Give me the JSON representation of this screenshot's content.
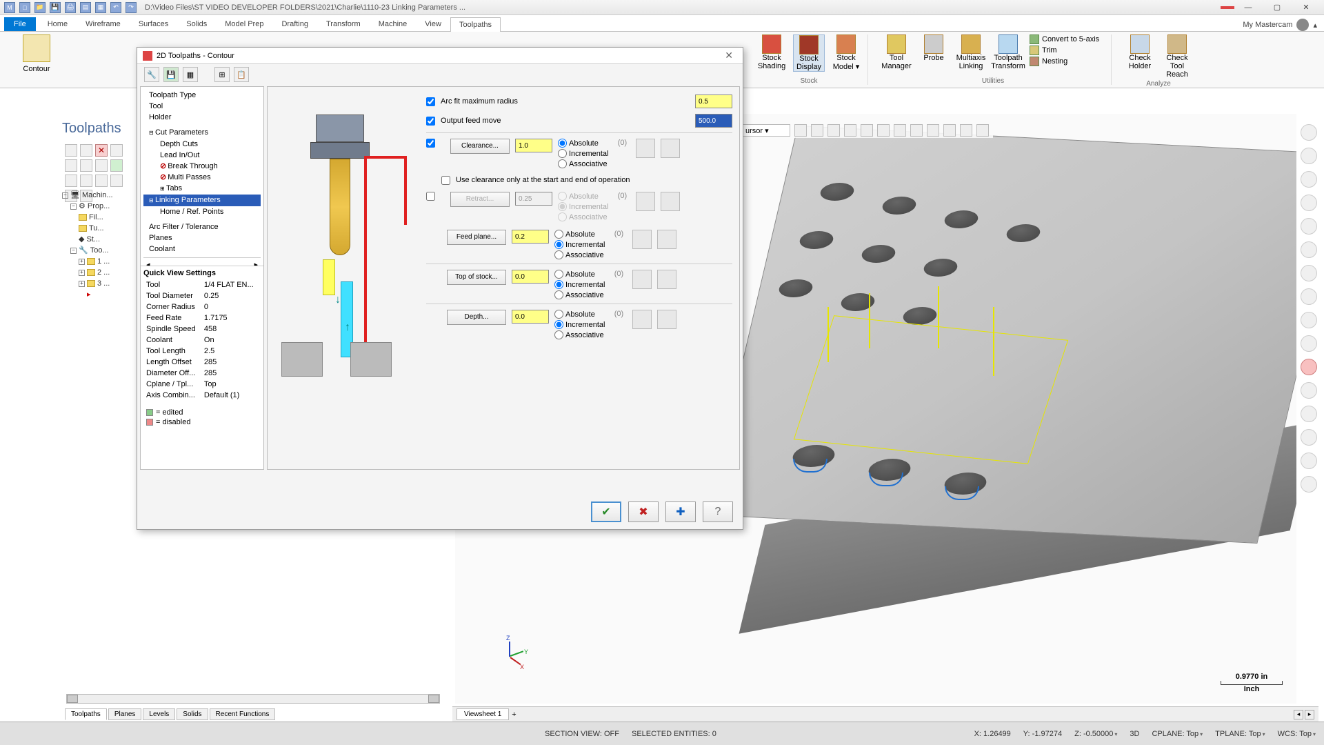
{
  "titlebar": {
    "path": "D:\\Video Files\\ST VIDEO DEVELOPER FOLDERS\\2021\\Charlie\\1110-23 Linking Parameters ...",
    "badge": ""
  },
  "ribbon": {
    "file": "File",
    "tabs": [
      "Home",
      "Wireframe",
      "Surfaces",
      "Solids",
      "Model Prep",
      "Drafting",
      "Transform",
      "Machine",
      "View",
      "Toolpaths"
    ],
    "active_tab": "Toolpaths",
    "user_label": "My Mastercam",
    "contour_label": "Contour",
    "groups": {
      "stock": {
        "label": "Stock",
        "items": [
          "Stock Shading",
          "Stock Display",
          "Stock Model ▾"
        ]
      },
      "utilities": {
        "label": "Utilities",
        "items": [
          "Tool Manager",
          "Probe",
          "Multiaxis Linking",
          "Toolpath Transform"
        ],
        "small": [
          {
            "label": "Convert to 5-axis"
          },
          {
            "label": "Trim"
          },
          {
            "label": "Nesting"
          }
        ]
      },
      "analyze": {
        "label": "Analyze",
        "items": [
          "Check Holder",
          "Check Tool Reach"
        ]
      }
    }
  },
  "toolpaths_panel_label": "Toolpaths",
  "tree": {
    "machine": "Machin...",
    "prop": "Prop...",
    "fil": "Fil...",
    "tu": "Tu...",
    "st": "St...",
    "too": "Too...",
    "n1": "1 ...",
    "n2": "2 ...",
    "n3": "3 ..."
  },
  "dialog": {
    "title": "2D Toolpaths - Contour",
    "tree": [
      {
        "label": "Toolpath Type",
        "level": 1
      },
      {
        "label": "Tool",
        "level": 1
      },
      {
        "label": "Holder",
        "level": 1
      },
      {
        "label": "Cut Parameters",
        "level": 1,
        "expandable": true
      },
      {
        "label": "Depth Cuts",
        "level": 2
      },
      {
        "label": "Lead In/Out",
        "level": 2
      },
      {
        "label": "Break Through",
        "level": 2,
        "off": true
      },
      {
        "label": "Multi Passes",
        "level": 2,
        "off": true
      },
      {
        "label": "Tabs",
        "level": 2,
        "expandable": true
      },
      {
        "label": "Linking Parameters",
        "level": 1,
        "selected": true,
        "expandable": true
      },
      {
        "label": "Home / Ref. Points",
        "level": 2
      },
      {
        "label": "Arc Filter / Tolerance",
        "level": 1
      },
      {
        "label": "Planes",
        "level": 1
      },
      {
        "label": "Coolant",
        "level": 1
      }
    ],
    "quick_view": {
      "title": "Quick View Settings",
      "rows": [
        [
          "Tool",
          "1/4 FLAT EN..."
        ],
        [
          "Tool Diameter",
          "0.25"
        ],
        [
          "Corner Radius",
          "0"
        ],
        [
          "Feed Rate",
          "1.7175"
        ],
        [
          "Spindle Speed",
          "458"
        ],
        [
          "Coolant",
          "On"
        ],
        [
          "Tool Length",
          "2.5"
        ],
        [
          "Length Offset",
          "285"
        ],
        [
          "Diameter Off...",
          "285"
        ],
        [
          "Cplane / Tpl...",
          "Top"
        ],
        [
          "Axis Combin...",
          "Default (1)"
        ]
      ]
    },
    "legend": {
      "edited": "= edited",
      "disabled": "= disabled"
    },
    "params": {
      "arc_fit_label": "Arc fit maximum radius",
      "arc_fit_value": "0.5",
      "output_feed_label": "Output feed move",
      "output_feed_value": "500.0",
      "clearance_btn": "Clearance...",
      "clearance_value": "1.0",
      "clearance_mode": {
        "absolute": "Absolute",
        "incremental": "Incremental",
        "associative": "Associative"
      },
      "use_clearance_only": "Use clearance only at the start and end of operation",
      "retract_btn": "Retract...",
      "retract_value": "0.25",
      "feed_plane_btn": "Feed plane...",
      "feed_plane_value": "0.2",
      "top_stock_btn": "Top of stock...",
      "top_stock_value": "0.0",
      "depth_btn": "Depth...",
      "depth_value": "0.0",
      "assoc_count": "(0)"
    }
  },
  "selbar": {
    "cursor_label": "ursor ▾"
  },
  "triad": {
    "x": "X",
    "y": "Y",
    "z": "Z"
  },
  "scale": {
    "value": "0.9770 in",
    "unit": "Inch"
  },
  "viewsheets": {
    "tab": "Viewsheet 1"
  },
  "bottom_tabs": [
    "Toolpaths",
    "Planes",
    "Levels",
    "Solids",
    "Recent Functions"
  ],
  "status": {
    "section": "SECTION VIEW: OFF",
    "selected": "SELECTED ENTITIES: 0",
    "x_label": "X:",
    "x": "1.26499",
    "y_label": "Y:",
    "y": "-1.97274",
    "z_label": "Z:",
    "z": "-0.50000",
    "mode": "3D",
    "cplane_label": "CPLANE:",
    "cplane": "Top",
    "tplane_label": "TPLANE:",
    "tplane": "Top",
    "wcs_label": "WCS:",
    "wcs": "Top"
  }
}
